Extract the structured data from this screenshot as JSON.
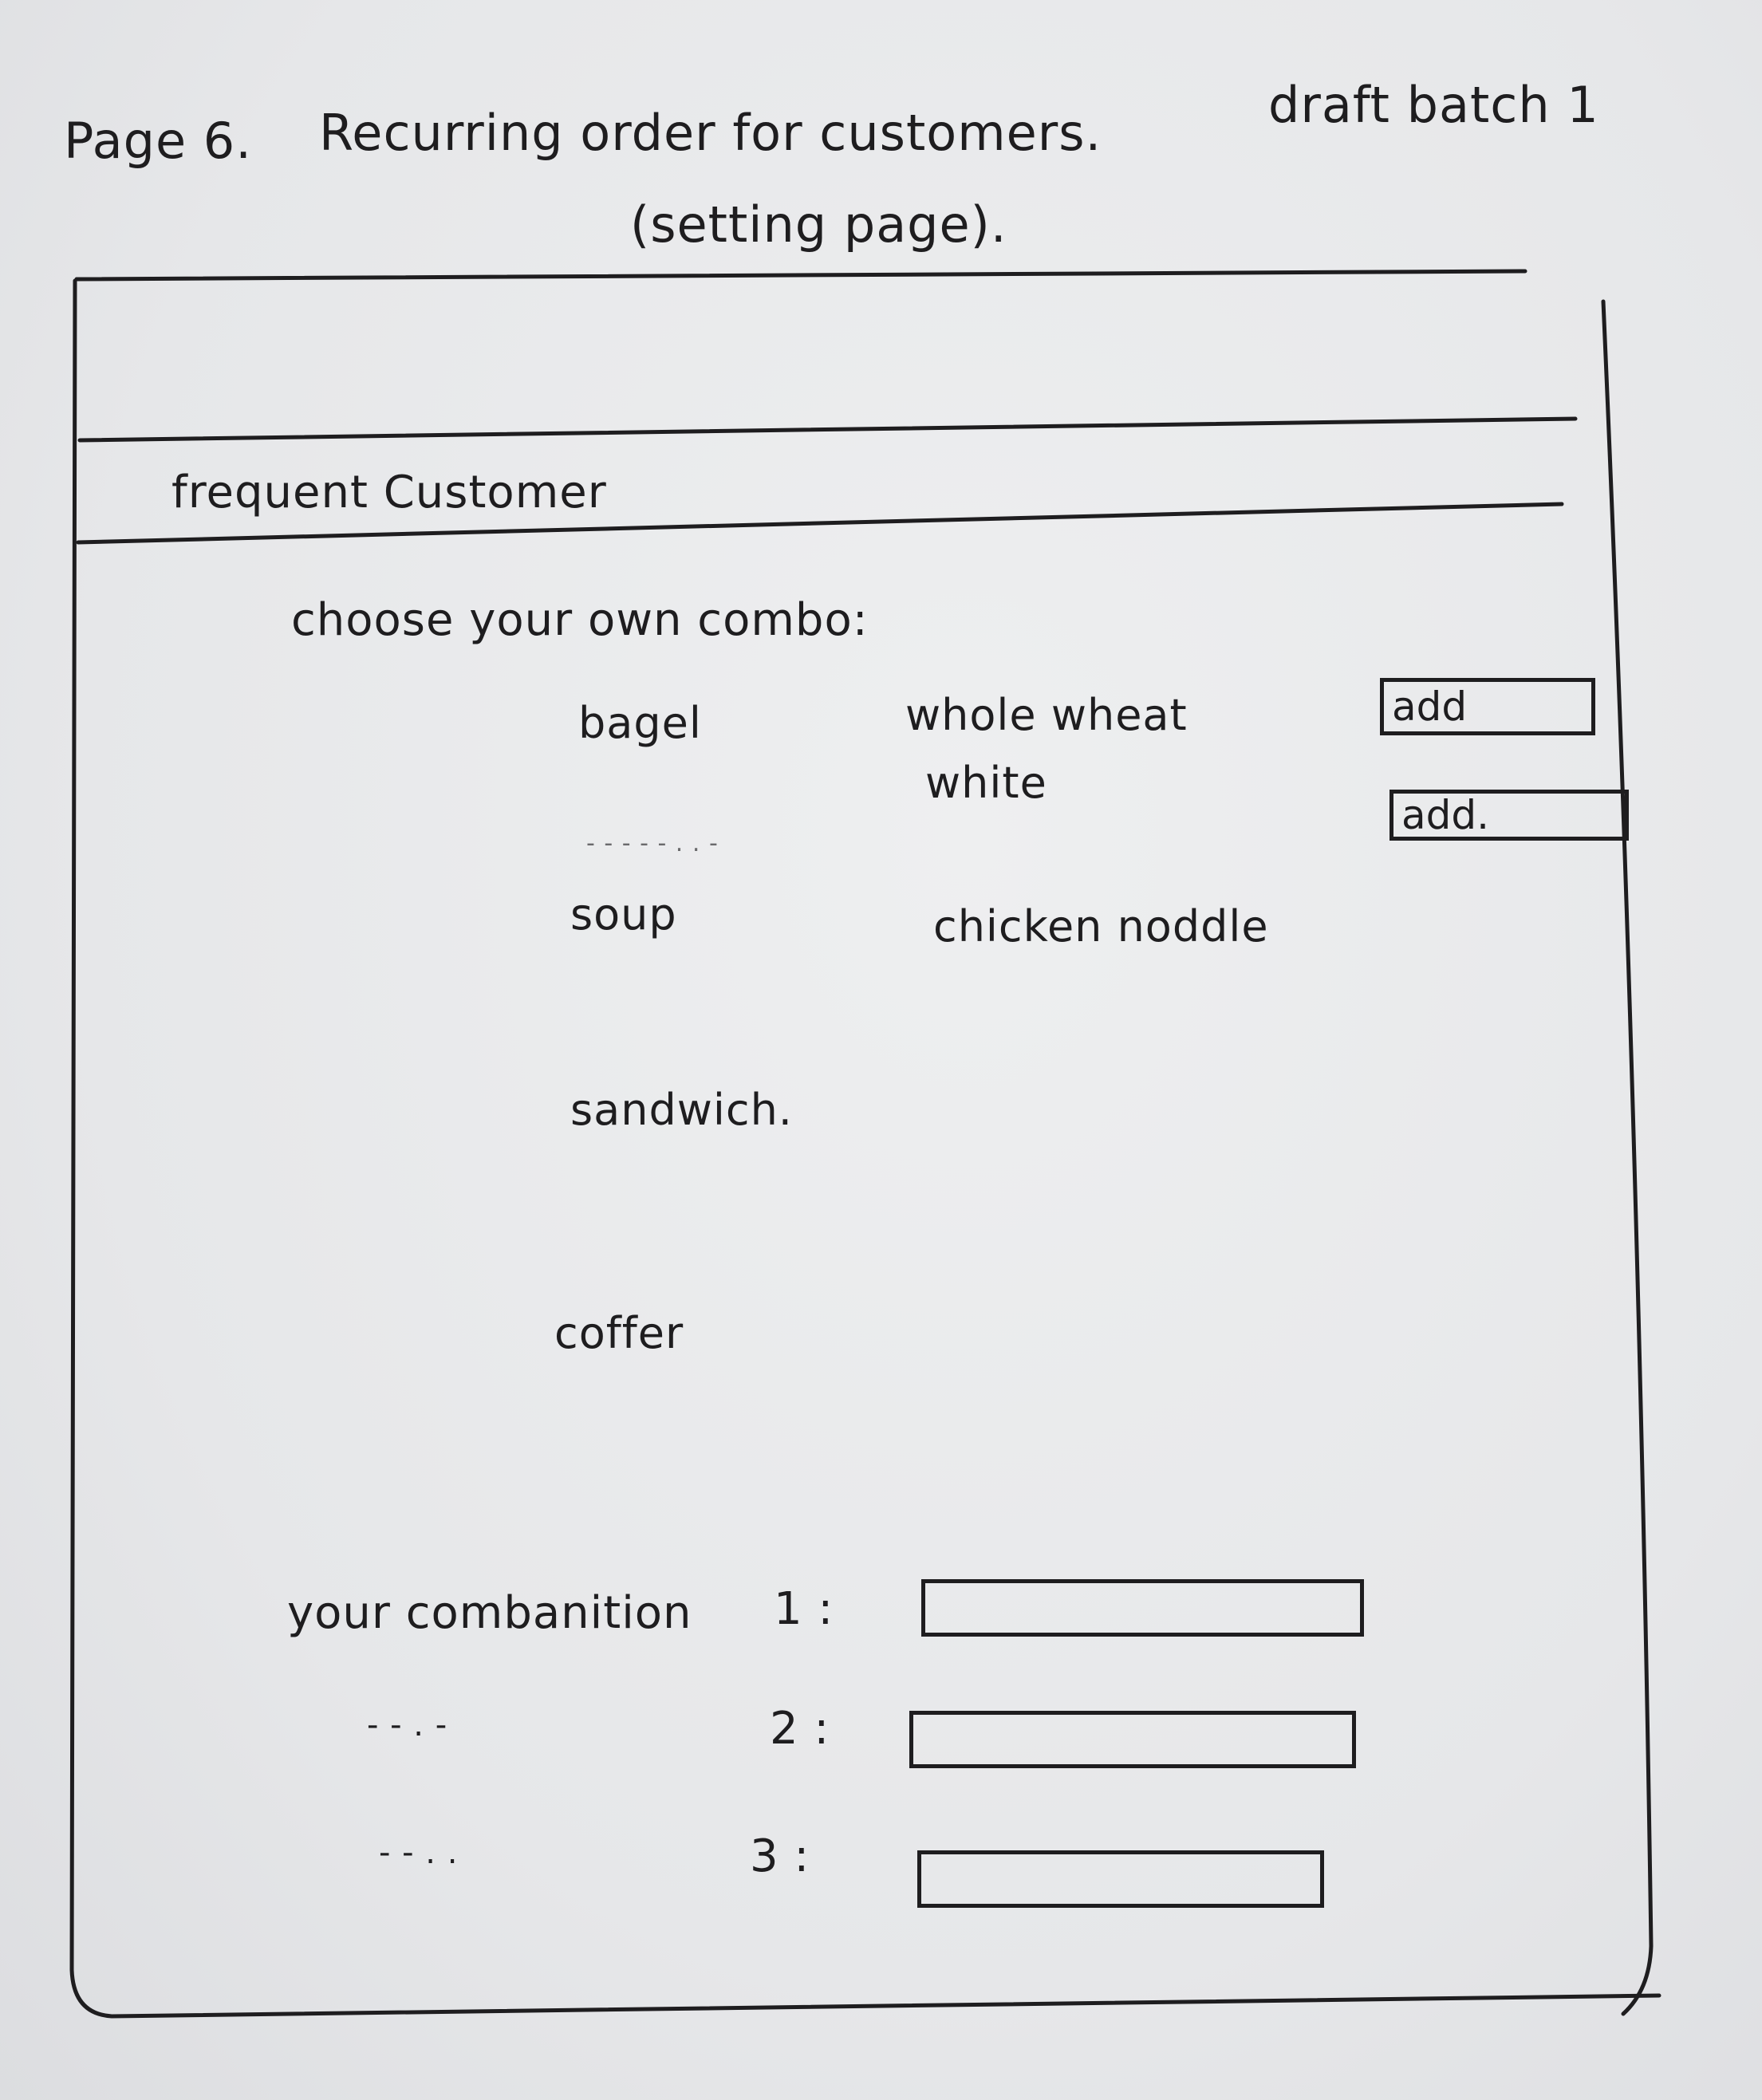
{
  "header": {
    "page_label": "Page 6.",
    "page_title": "Recurring order for customers.",
    "subtitle": "(setting page).",
    "draft_note": "draft batch 1"
  },
  "section": {
    "title": "frequent Customer"
  },
  "combo": {
    "heading": "choose your own combo:",
    "items": [
      {
        "label": "bagel",
        "options": [
          "whole wheat",
          "white"
        ],
        "add_labels": [
          "add",
          "add."
        ]
      },
      {
        "label": "soup",
        "options": [
          "chicken noddle"
        ]
      },
      {
        "label": "sandwich."
      },
      {
        "label": "coffer"
      }
    ],
    "ditto_marks": "- - -   - - .   . -"
  },
  "combinations": {
    "label_prefix": "your combanition",
    "rows": [
      {
        "number": "1 :",
        "prefix": "your combanition"
      },
      {
        "number": "2 :",
        "prefix": "- -   . -"
      },
      {
        "number": "3 :",
        "prefix": "- -   . ."
      }
    ]
  },
  "icons": {}
}
